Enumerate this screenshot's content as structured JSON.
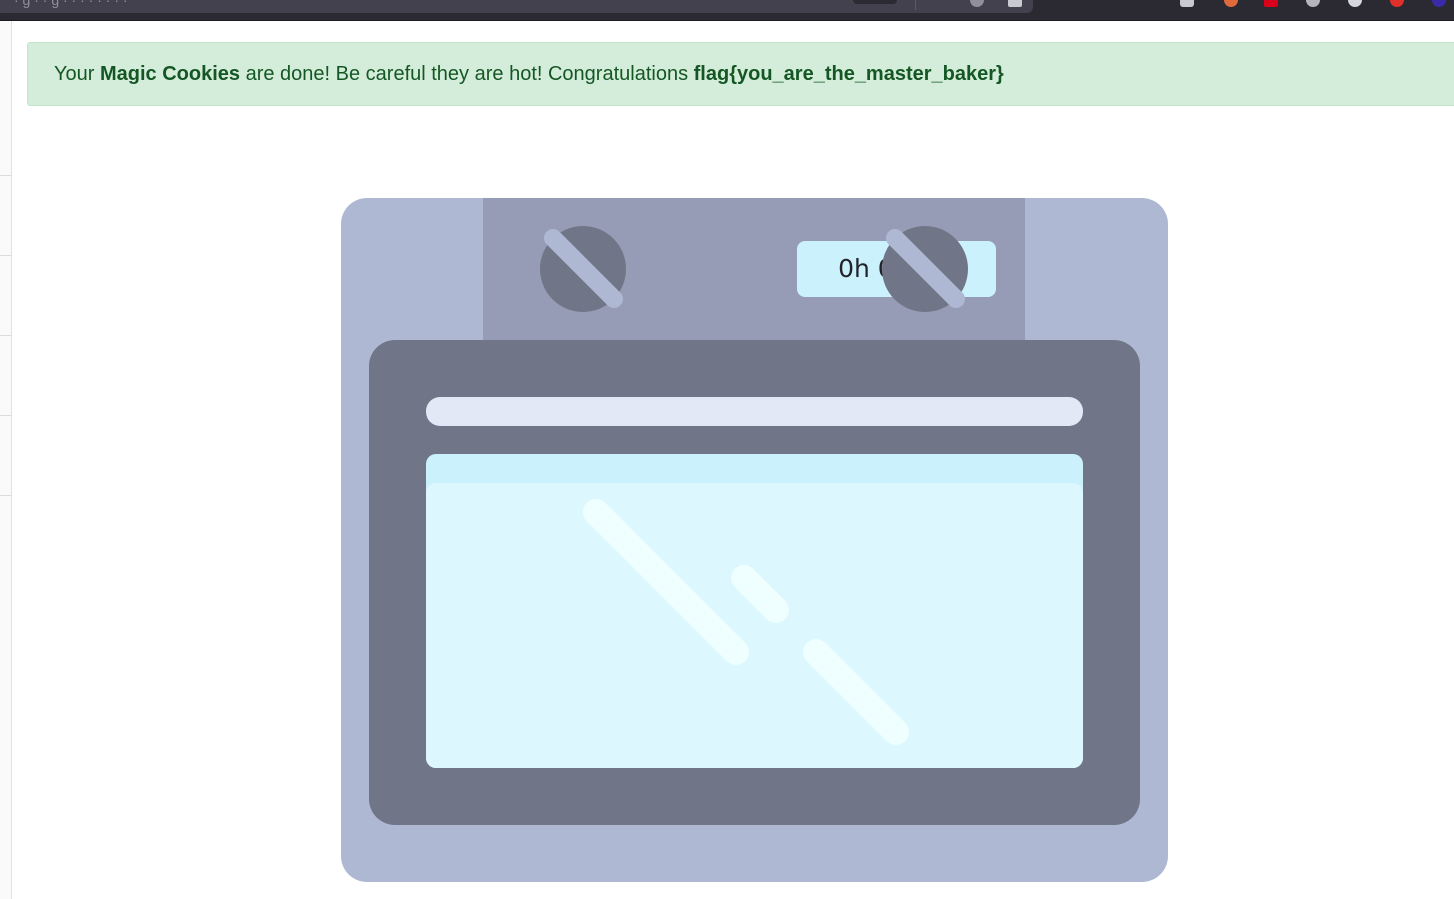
{
  "browser": {
    "url_text": "· g · · g · · · · · · · ·"
  },
  "alert": {
    "prefix": "Your ",
    "product": "Magic Cookies",
    "middle": " are done! Be careful they are hot! Congratulations ",
    "flag": "flag{you_are_the_master_baker}",
    "color": "#155724",
    "background": "#d4edda"
  },
  "oven": {
    "timer": "0h 0m 0s",
    "icons": {
      "left_knob": "knob-icon",
      "right_knob": "knob-icon"
    },
    "colors": {
      "body": "#aeb8d3",
      "panel": "#969cb5",
      "door": "#707587",
      "handle": "#e2e8f5",
      "glass": "#dcf7fd",
      "display": "#caf1fc"
    }
  }
}
